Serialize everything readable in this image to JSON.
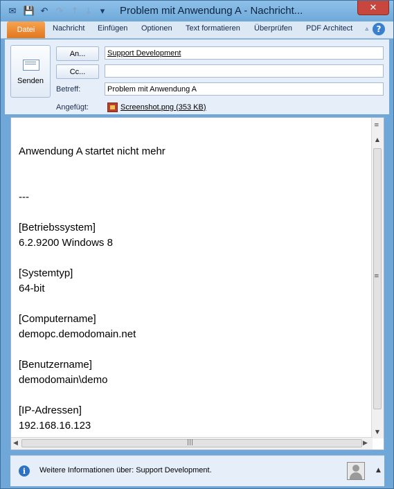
{
  "window": {
    "title": "Problem mit Anwendung A  -  Nachricht...",
    "close": "✕"
  },
  "quick_access": [
    {
      "name": "app-icon",
      "glyph": "✉"
    },
    {
      "name": "save-icon",
      "glyph": "💾"
    },
    {
      "name": "undo-icon",
      "glyph": "↶"
    },
    {
      "name": "redo-icon",
      "glyph": "↷"
    },
    {
      "name": "up-icon",
      "glyph": "↑"
    },
    {
      "name": "down-icon",
      "glyph": "↓"
    },
    {
      "name": "customize-icon",
      "glyph": "▾"
    }
  ],
  "menu": {
    "file": "Datei",
    "tabs": [
      "Nachricht",
      "Einfügen",
      "Optionen",
      "Text formatieren",
      "Überprüfen",
      "PDF Architect"
    ],
    "help": "?",
    "minimize_ribbon": "▵"
  },
  "header": {
    "send_label": "Senden",
    "to_button": "An...",
    "cc_button": "Cc...",
    "subject_label": "Betreff:",
    "attached_label": "Angefügt:",
    "to_value": "Support Development",
    "cc_value": "",
    "subject_value": "Problem mit Anwendung A",
    "attachment": "Screenshot.png (353 KB)"
  },
  "body": {
    "lines": [
      "Anwendung A startet nicht mehr",
      "",
      "",
      "---",
      "",
      "[Betriebssystem]",
      "6.2.9200 Windows 8",
      "",
      "[Systemtyp]",
      "64-bit",
      "",
      "[Computername]",
      "demopc.demodomain.net",
      "",
      "[Benutzername]",
      "demodomain\\demo",
      "",
      "[IP-Adressen]",
      "192.168.16.123"
    ]
  },
  "scroll": {
    "up": "▲",
    "down": "▼",
    "left": "◀",
    "right": "▶",
    "grip": "≡",
    "hgrip": "|||"
  },
  "infobar": {
    "icon": "i",
    "text": "Weitere Informationen über: Support Development.",
    "expand": "▲"
  }
}
